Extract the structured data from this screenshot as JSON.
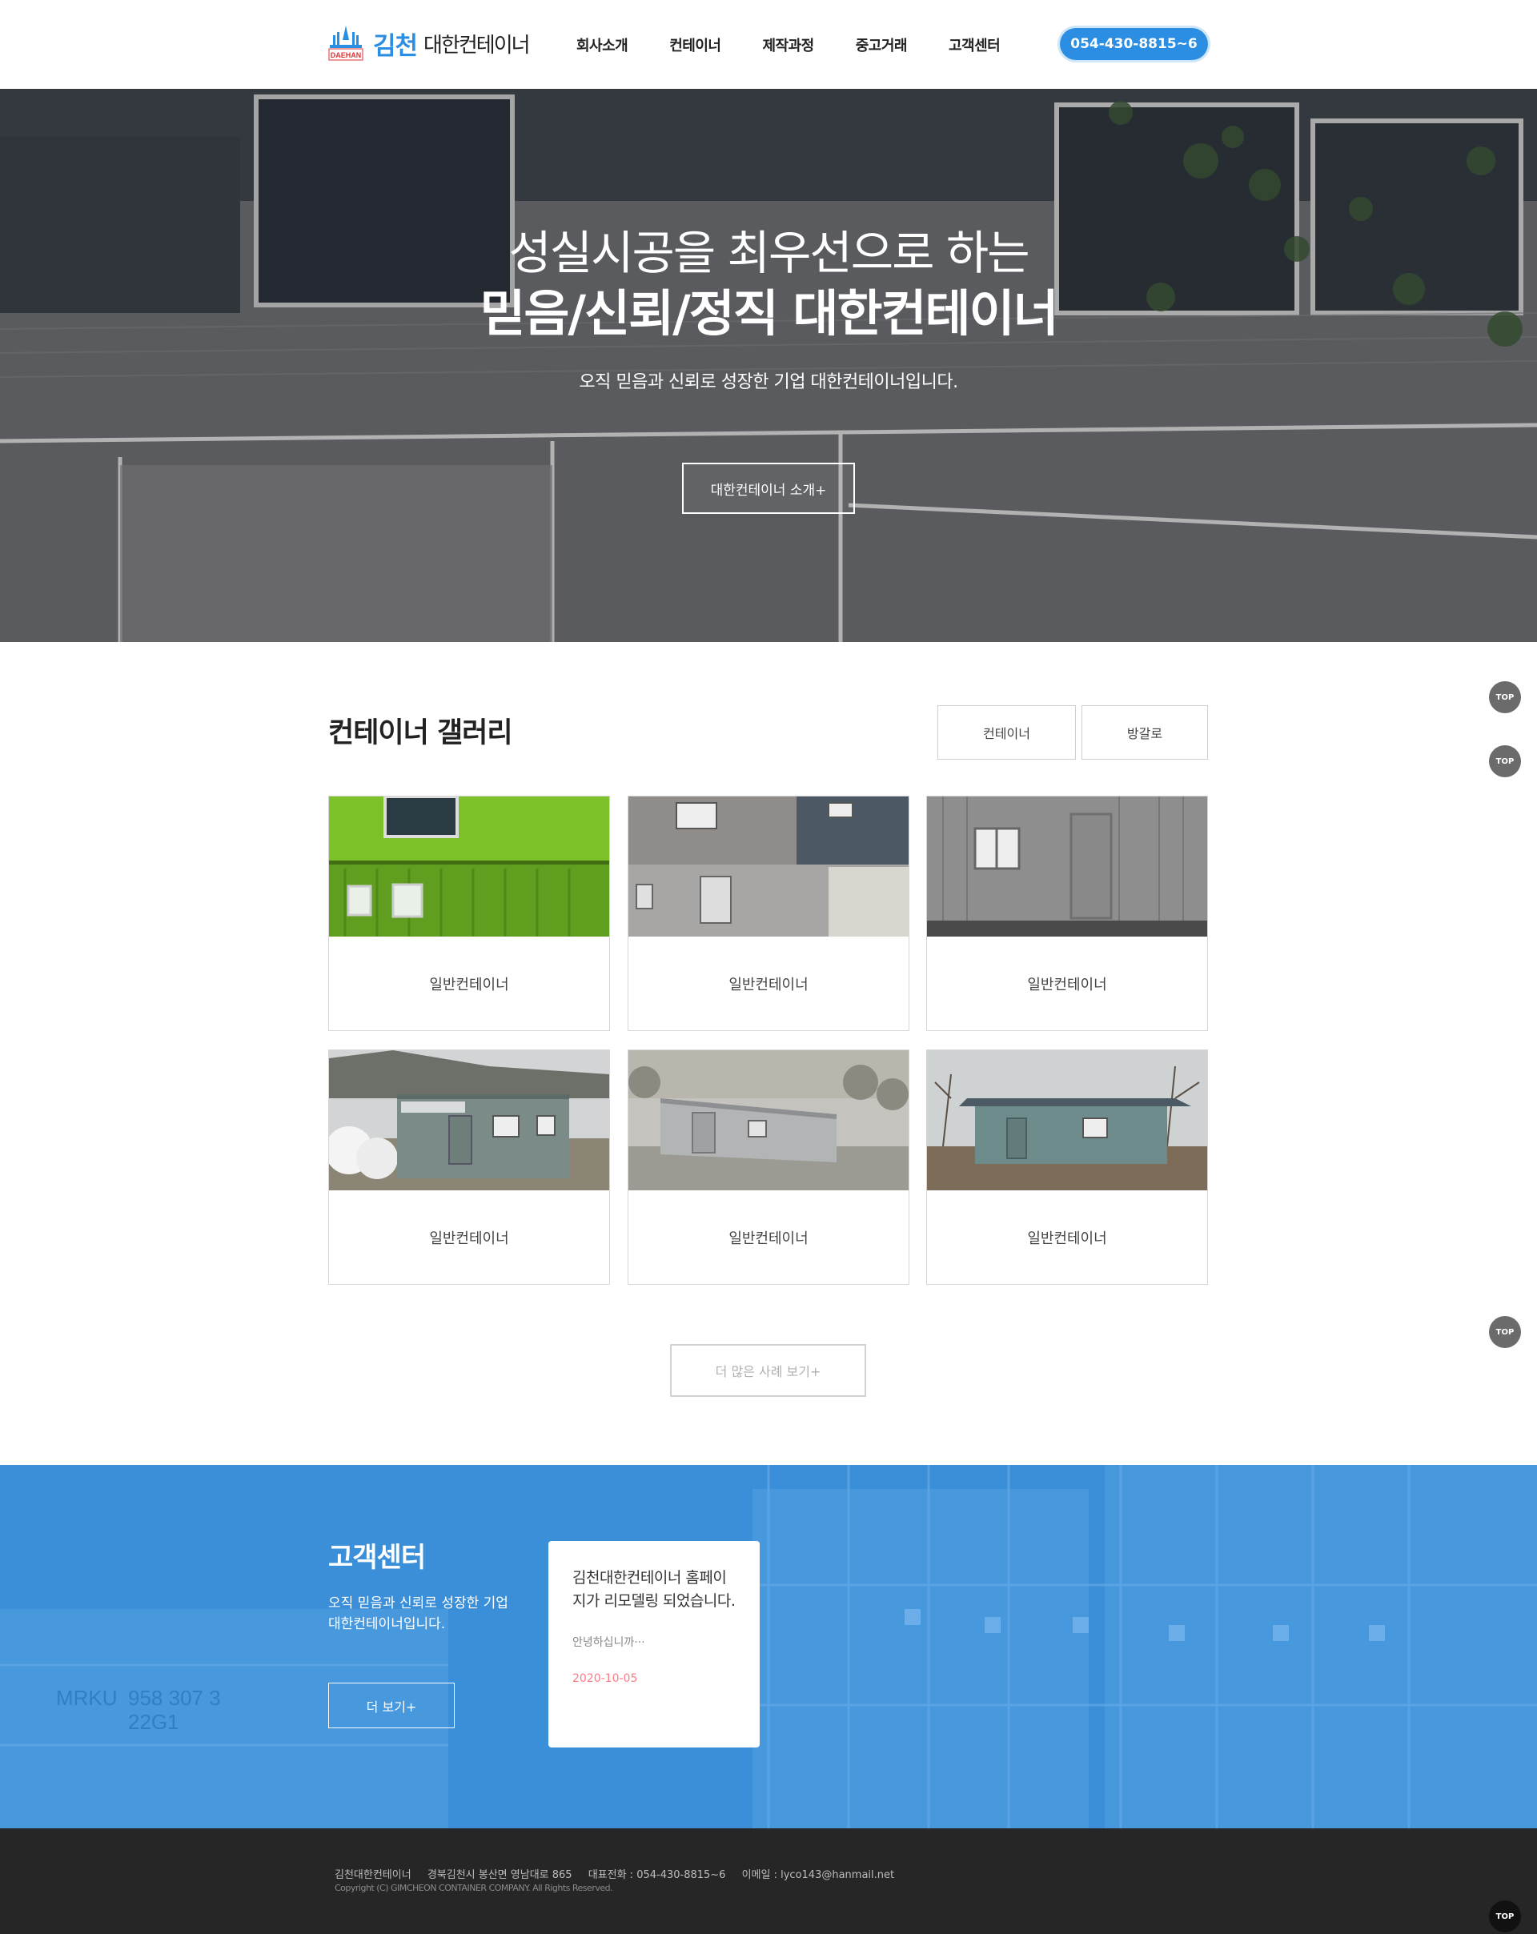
{
  "header": {
    "logo_accent": "김천",
    "logo_text": "대한컨테이너",
    "logo_mark_text": "DAEHAN",
    "nav": [
      "회사소개",
      "컨테이너",
      "제작과정",
      "중고거래",
      "고객센터"
    ],
    "phone": "054-430-8815~6",
    "brand_color": "#2b8ee2"
  },
  "hero": {
    "title_line1": "성실시공을 최우선으로 하는",
    "title_line2": "믿음/신뢰/정직 대한컨테이너",
    "subtitle": "오직 믿음과 신뢰로 성장한 기업 대한컨테이너입니다.",
    "button_label": "대한컨테이너 소개+"
  },
  "gallery": {
    "title": "컨테이너 갤러리",
    "filters": [
      "컨테이너",
      "방갈로"
    ],
    "items": [
      {
        "label": "일반컨테이너",
        "icon": "green-container-photo"
      },
      {
        "label": "일반컨테이너",
        "icon": "gray-stacked-container-photo"
      },
      {
        "label": "일반컨테이너",
        "icon": "gray-container-window-photo"
      },
      {
        "label": "일반컨테이너",
        "icon": "office-container-photo"
      },
      {
        "label": "일반컨테이너",
        "icon": "silver-container-row-photo"
      },
      {
        "label": "일반컨테이너",
        "icon": "bungalow-container-photo"
      }
    ],
    "more_label": "더 많은 사례 보기+"
  },
  "side_buttons": [
    "TOP",
    "TOP",
    "TOP",
    "TOP"
  ],
  "customer_center": {
    "title": "고객센터",
    "description": "오직 믿음과 신뢰로 성장한 기업 대한컨테이너입니다.",
    "button_label": "더 보기+",
    "notice": {
      "title": "김천대한컨테이너 홈페이지가 리모델링 되었습니다.",
      "body": "안녕하십니까···",
      "date": "2020-10-05"
    },
    "background_color": "#3a8fd8"
  },
  "footer": {
    "company": "김천대한컨테이너",
    "address": "경북김천시 봉산면 영남대로 865",
    "phone": "대표전화 : 054-430-8815~6",
    "email": "이메일 : lyco143@hanmail.net",
    "copyright": "Copyright (C) GIMCHEON CONTAINER COMPANY. All Rights Reserved."
  }
}
